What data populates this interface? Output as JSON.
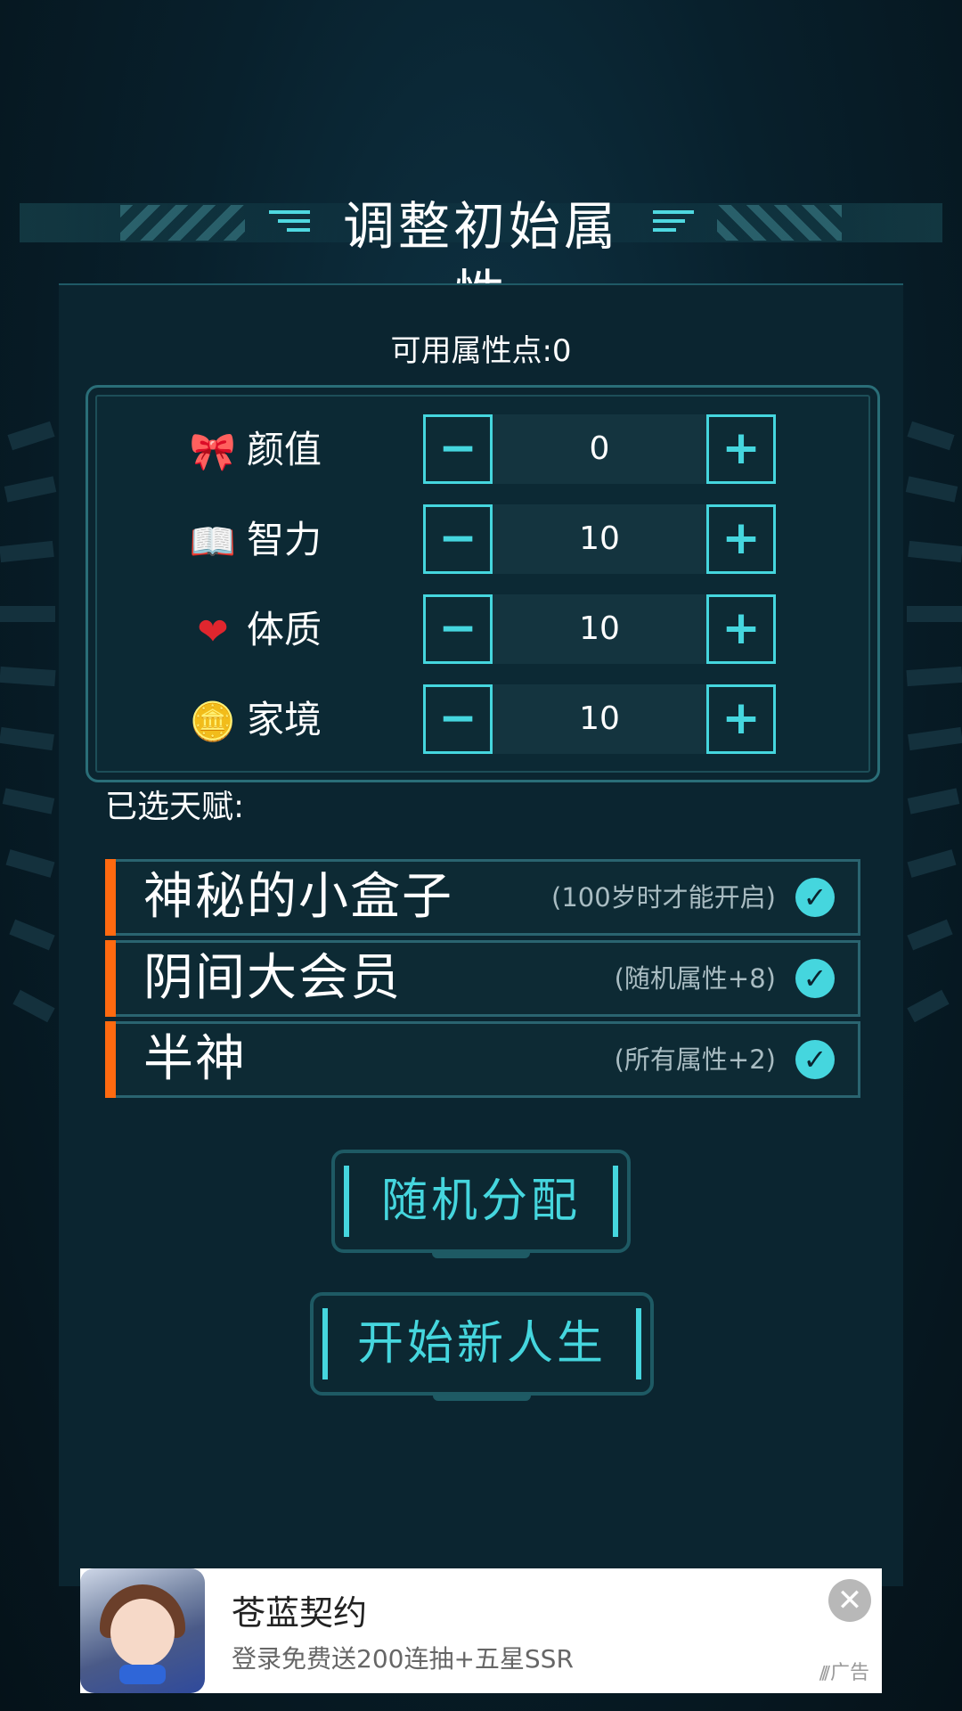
{
  "header": {
    "title": "调整初始属性"
  },
  "points": {
    "label": "可用属性点:0"
  },
  "attributes": [
    {
      "label": "颜值",
      "value": "0",
      "icon": "bow-icon",
      "icon_glyph": "🎀"
    },
    {
      "label": "智力",
      "value": "10",
      "icon": "book-icon",
      "icon_glyph": "📖"
    },
    {
      "label": "体质",
      "value": "10",
      "icon": "heart-icon",
      "icon_glyph": "❤"
    },
    {
      "label": "家境",
      "value": "10",
      "icon": "coin-icon",
      "icon_glyph": "🪙"
    }
  ],
  "stepper": {
    "minus": "−",
    "plus": "+"
  },
  "talents": {
    "label": "已选天赋:",
    "items": [
      {
        "name": "神秘的小盒子",
        "desc": "(100岁时才能开启)"
      },
      {
        "name": "阴间大会员",
        "desc": "(随机属性+8)"
      },
      {
        "name": "半神",
        "desc": "(所有属性+2)"
      }
    ],
    "check_glyph": "✓"
  },
  "buttons": {
    "random": "随机分配",
    "start": "开始新人生"
  },
  "ad": {
    "title": "苍蓝契约",
    "subtitle": "登录免费送200连抽+五星SSR",
    "close_glyph": "✕",
    "tag": "广告"
  },
  "colors": {
    "accent": "#45d6de",
    "talent_bar": "#ff6a10",
    "panel": "#0b2530"
  }
}
